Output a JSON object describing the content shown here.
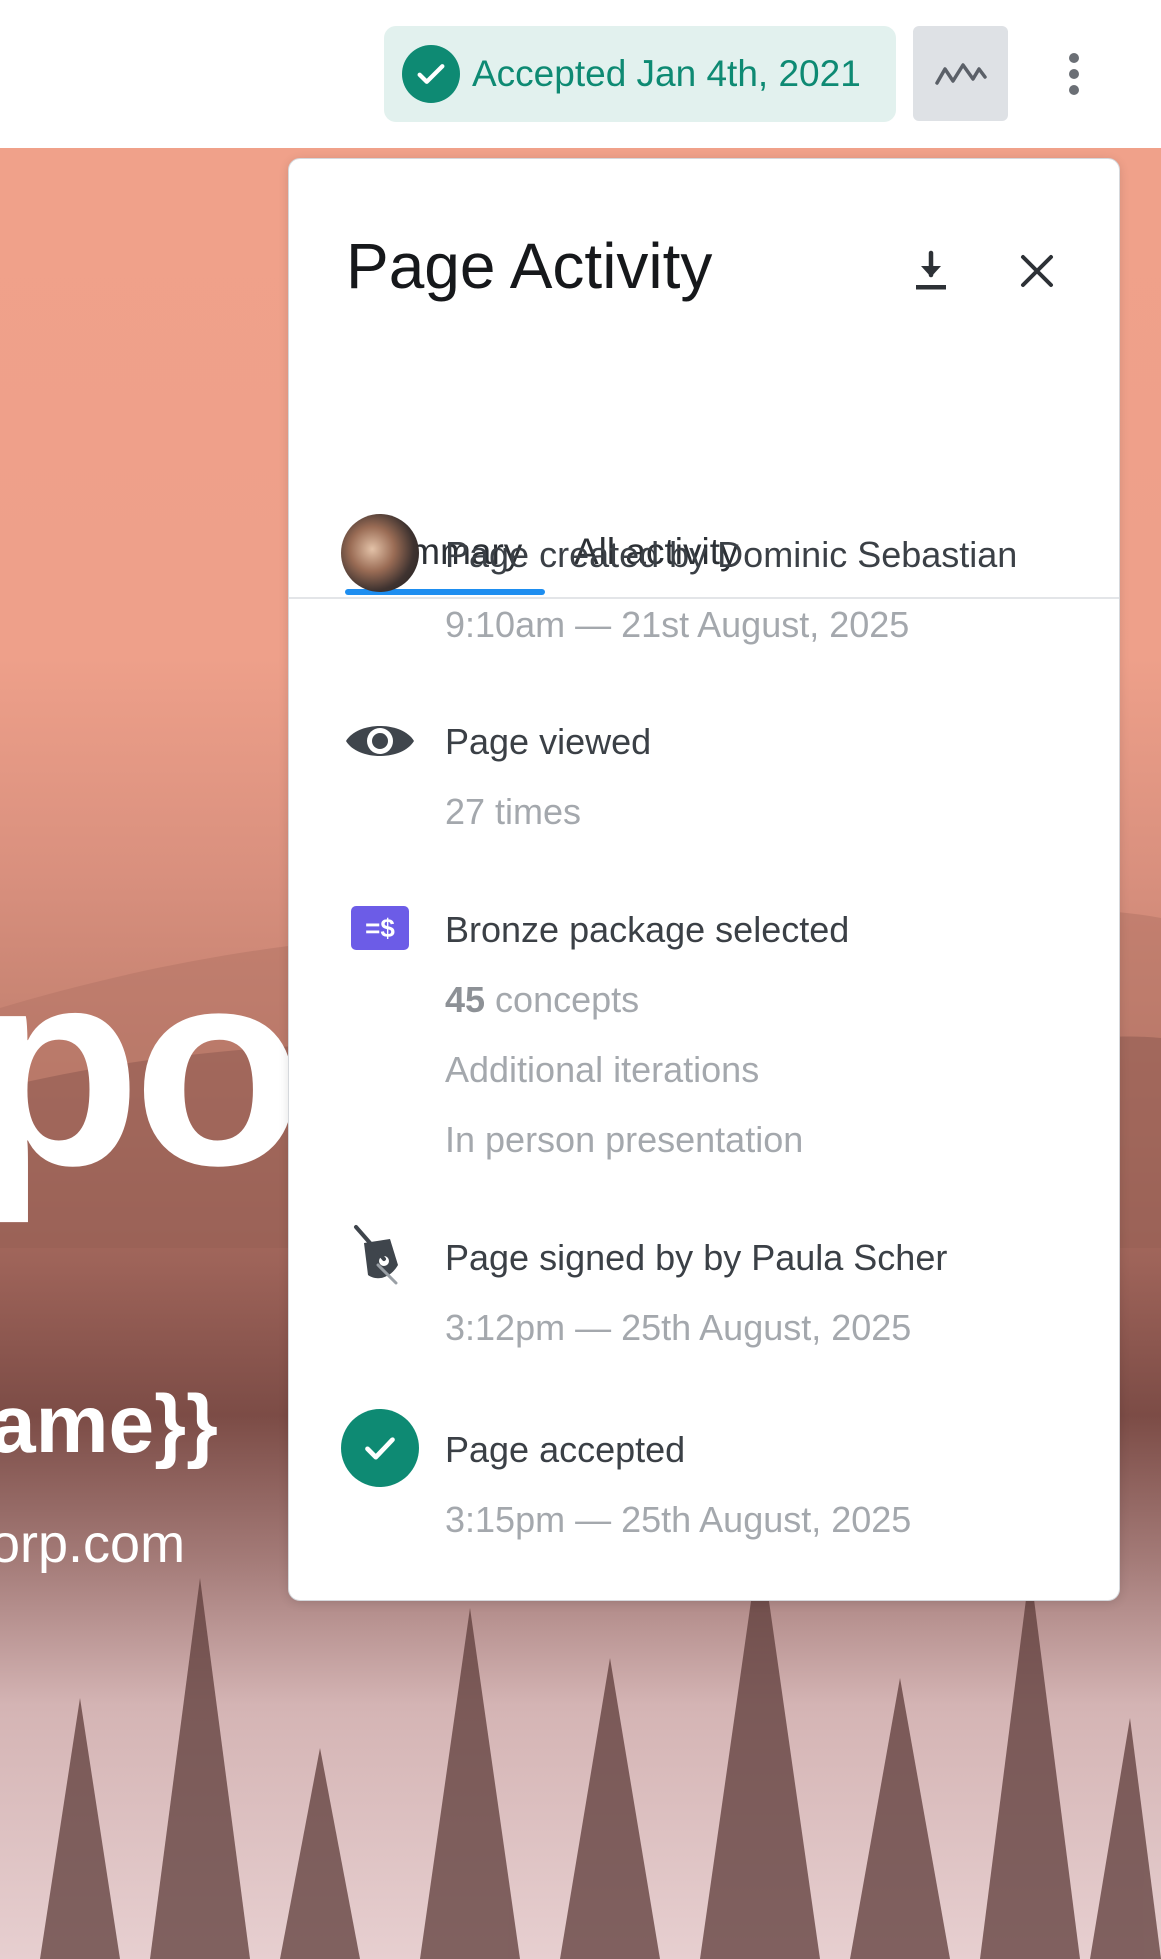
{
  "header": {
    "accepted_label": "Accepted Jan 4th, 2021",
    "accent_color": "#0e8a73"
  },
  "background": {
    "big_text": "po",
    "name_text": "ame}}",
    "email_text": "orp.com"
  },
  "panel": {
    "title": "Page Activity",
    "tabs": [
      {
        "label": "Summary",
        "active": true
      },
      {
        "label": "All activity",
        "active": false
      }
    ],
    "events": [
      {
        "icon": "avatar-photo",
        "title": "Page created by Dominic Sebastian",
        "detail": "9:10am — 21st August, 2025"
      },
      {
        "icon": "eye-icon",
        "title": "Page viewed",
        "detail": "27 times"
      },
      {
        "icon": "package-icon",
        "icon_text": "=$",
        "title": "Bronze package selected",
        "count": "45",
        "count_suffix": " concepts",
        "lines": [
          "Additional iterations",
          "In person presentation"
        ]
      },
      {
        "icon": "signature-icon",
        "title": "Page signed by by Paula Scher",
        "detail": "3:12pm — 25th August, 2025"
      },
      {
        "icon": "check-circle-icon",
        "title": "Page accepted",
        "detail": "3:15pm — 25th August, 2025"
      }
    ]
  }
}
